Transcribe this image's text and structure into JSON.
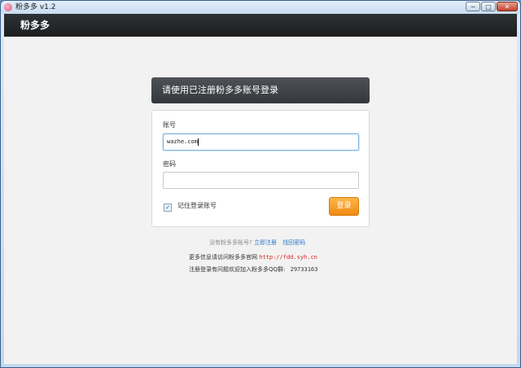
{
  "window": {
    "title": "粉多多 v1.2",
    "minimize": "─",
    "maximize": "□",
    "close": "✕"
  },
  "header": {
    "title": "粉多多"
  },
  "login": {
    "heading": "请使用已注册粉多多账号登录",
    "account_label": "账号",
    "account_value": "wazhe.com",
    "password_label": "密码",
    "password_value": "",
    "remember_checked": true,
    "remember_check_glyph": "✓",
    "remember_label": "记住登录账号",
    "login_button": "登录"
  },
  "links": {
    "no_account": "没有粉多多账号?",
    "register": "立即注册",
    "recover": "找回密码"
  },
  "info": {
    "site_prefix": "更多信息请访问粉多多官网",
    "site_url": "http://fdd.syh.cn",
    "qq_prefix": "注册登录有问题欢迎加入粉多多QQ群:",
    "qq_number": "29733163"
  },
  "colors": {
    "accent_orange": "#f08a12",
    "header_dark": "#1c1e20",
    "link_blue": "#2a78c8",
    "url_red": "#dd2222"
  }
}
